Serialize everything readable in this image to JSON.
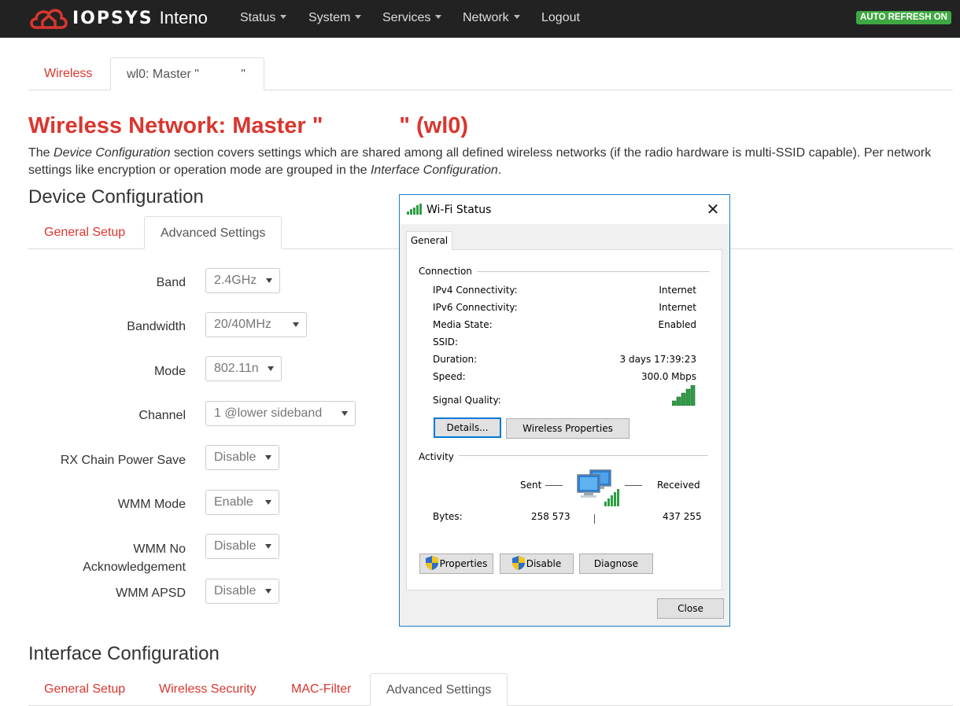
{
  "navbar": {
    "brand_iopsys": "IOPSYS",
    "brand_inteno": "Inteno",
    "items": [
      {
        "label": "Status",
        "dropdown": true
      },
      {
        "label": "System",
        "dropdown": true
      },
      {
        "label": "Services",
        "dropdown": true
      },
      {
        "label": "Network",
        "dropdown": true
      },
      {
        "label": "Logout",
        "dropdown": false
      }
    ],
    "auto_refresh": "AUTO REFRESH ON"
  },
  "page_tabs": [
    {
      "label": "Wireless",
      "active": false
    },
    {
      "label": "wl0: Master \"            \"",
      "active": true
    }
  ],
  "page_title": "Wireless Network: Master \"            \" (wl0)",
  "description": {
    "p1": "The ",
    "em1": "Device Configuration",
    "p2": " section covers settings which are shared among all defined wireless networks (if the radio hardware is multi-SSID capable). Per network settings like encryption or operation mode are grouped in the ",
    "em2": "Interface Configuration",
    "p3": "."
  },
  "device_config": {
    "heading": "Device Configuration",
    "tabs": [
      {
        "label": "General Setup",
        "active": false
      },
      {
        "label": "Advanced Settings",
        "active": true
      }
    ],
    "fields": [
      {
        "label": "Band",
        "value": "2.4GHz"
      },
      {
        "label": "Bandwidth",
        "value": "20/40MHz"
      },
      {
        "label": "Mode",
        "value": "802.11n"
      },
      {
        "label": "Channel",
        "value": "1 @lower sideband"
      },
      {
        "label": "RX Chain Power Save",
        "value": "Disable"
      },
      {
        "label": "WMM Mode",
        "value": "Enable"
      },
      {
        "label": "WMM No Acknowledgement",
        "label_line1": "WMM No",
        "label_line2": "Acknowledgement",
        "value": "Disable"
      },
      {
        "label": "WMM APSD",
        "value": "Disable"
      }
    ]
  },
  "interface_config": {
    "heading": "Interface Configuration",
    "tabs": [
      {
        "label": "General Setup",
        "active": false
      },
      {
        "label": "Wireless Security",
        "active": false
      },
      {
        "label": "MAC-Filter",
        "active": false
      },
      {
        "label": "Advanced Settings",
        "active": true
      }
    ]
  },
  "wifi_dialog": {
    "title": "Wi-Fi Status",
    "tab": "General",
    "connection_label": "Connection",
    "rows": [
      {
        "label": "IPv4 Connectivity:",
        "value": "Internet"
      },
      {
        "label": "IPv6 Connectivity:",
        "value": "Internet"
      },
      {
        "label": "Media State:",
        "value": "Enabled"
      },
      {
        "label": "SSID:",
        "value": ""
      },
      {
        "label": "Duration:",
        "value": "3 days 17:39:23"
      },
      {
        "label": "Speed:",
        "value": "300.0 Mbps"
      }
    ],
    "signal_label": "Signal Quality:",
    "signal_bars": 5,
    "details_button": "Details...",
    "wireless_properties_button": "Wireless Properties",
    "activity_label": "Activity",
    "sent_label": "Sent",
    "received_label": "Received",
    "bytes_label": "Bytes:",
    "bytes_sent": "258 573",
    "bytes_received": "437 255",
    "properties_button": "Properties",
    "disable_button": "Disable",
    "diagnose_button": "Diagnose",
    "close_button": "Close",
    "icons": {
      "title": "wifi-signal-icon",
      "close": "close-icon",
      "network": "network-computers-icon",
      "shield": "uac-shield-icon"
    }
  },
  "colors": {
    "accent_red": "#d9362f",
    "navbar_bg": "#222222",
    "auto_refresh_bg": "#3fa843",
    "dialog_border": "#1f7fc9",
    "signal_green": "#2e9e45"
  }
}
